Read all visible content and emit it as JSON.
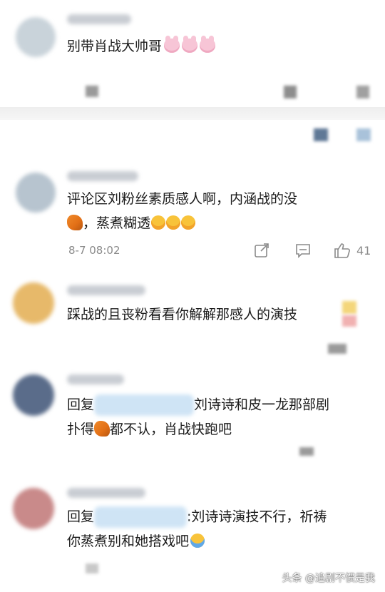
{
  "comments": [
    {
      "id": "c1",
      "text_lines": [
        "别带肖战大帅哥"
      ],
      "avatar_color": "#c9d3da"
    },
    {
      "id": "c2",
      "text_lines": [
        "评论区刘粉丝素质感人啊，内涵战的没",
        "，蒸煮糊透"
      ],
      "time": "8-7 08:02",
      "likes": "41",
      "avatar_color": "#b7c4cf"
    },
    {
      "id": "c3",
      "text_lines": [
        "踩战的且丧粉看看你解解那感人的演技"
      ],
      "avatar_color": "#e7b96a"
    },
    {
      "id": "c4",
      "reply_prefix": "回复",
      "text_lines": [
        "刘诗诗和皮一龙那部剧",
        "扑得",
        "都不认，肖战快跑吧"
      ],
      "avatar_color": "#5a6c8a"
    },
    {
      "id": "c5",
      "reply_prefix": "回复",
      "text_lines": [
        ":刘诗诗演技不行，祈祷",
        "你蒸煮别和她搭戏吧"
      ],
      "avatar_color": "#c98a8a"
    }
  ],
  "watermark": "头条 @追剧不惯是我",
  "colors": {
    "text": "#1b1b1b",
    "muted": "#8a8a8a",
    "blur_blue": "#cfe4f5",
    "swatch_dark": "#5f7896",
    "swatch_light": "#a9c2da"
  }
}
